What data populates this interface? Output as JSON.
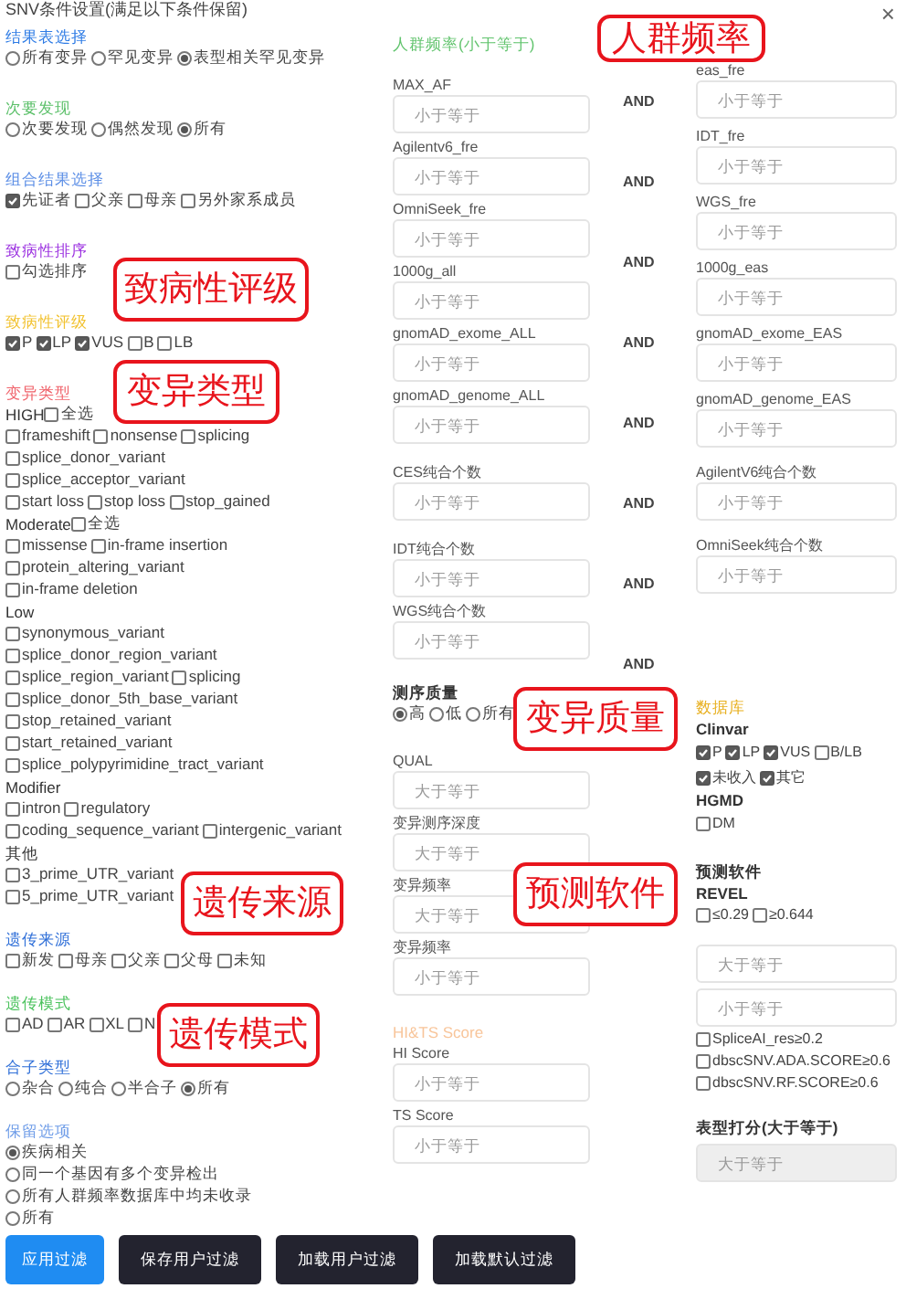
{
  "window": {
    "title": "SNV条件设置(满足以下条件保留)",
    "close": "×"
  },
  "left_sections": [
    {
      "title": "结果表选择",
      "color": "#2d7be5",
      "kind": "radio",
      "options": [
        {
          "label": "所有变异",
          "selected": false
        },
        {
          "label": "罕见变异",
          "selected": false
        },
        {
          "label": "表型相关罕见变异",
          "selected": true
        }
      ]
    },
    {
      "title": "次要发现",
      "color": "#5cc06a",
      "kind": "radio",
      "options": [
        {
          "label": "次要发现",
          "selected": false
        },
        {
          "label": "偶然发现",
          "selected": false
        },
        {
          "label": "所有",
          "selected": true
        }
      ]
    },
    {
      "title": "组合结果选择",
      "color": "#5b8ee6",
      "kind": "check",
      "options": [
        {
          "label": "先证者",
          "checked": true
        },
        {
          "label": "父亲",
          "checked": false
        },
        {
          "label": "母亲",
          "checked": false
        },
        {
          "label": "另外家系成员",
          "checked": false
        }
      ]
    },
    {
      "title": "致病性排序",
      "color": "#9b30e0",
      "kind": "check",
      "options": [
        {
          "label": "勾选排序",
          "checked": false
        }
      ]
    },
    {
      "title": "致病性评级",
      "color": "#f2c230",
      "kind": "check",
      "options": [
        {
          "label": "P",
          "checked": true
        },
        {
          "label": "LP",
          "checked": true
        },
        {
          "label": "VUS",
          "checked": true
        },
        {
          "label": "B",
          "checked": false
        },
        {
          "label": "LB",
          "checked": false
        }
      ]
    },
    {
      "title": "变异类型",
      "color": "#f0636b",
      "kind": "types",
      "groups": [
        {
          "name": "HIGH",
          "select_all": {
            "label": "全选",
            "checked": false
          },
          "lines": [
            {
              "options": [
                {
                  "label": "frameshift",
                  "checked": false
                },
                {
                  "label": "nonsense",
                  "checked": false
                },
                {
                  "label": "splicing",
                  "checked": false
                }
              ]
            },
            {
              "options": [
                {
                  "label": "splice_donor_variant",
                  "checked": false
                }
              ]
            },
            {
              "options": [
                {
                  "label": "splice_acceptor_variant",
                  "checked": false
                }
              ]
            },
            {
              "options": [
                {
                  "label": "start loss",
                  "checked": false
                },
                {
                  "label": "stop loss",
                  "checked": false
                },
                {
                  "label": "stop_gained",
                  "checked": false
                }
              ]
            }
          ]
        },
        {
          "name": "Moderate",
          "select_all": {
            "label": "全选",
            "checked": false
          },
          "lines": [
            {
              "options": [
                {
                  "label": "missense",
                  "checked": false
                },
                {
                  "label": "in-frame insertion",
                  "checked": false
                }
              ]
            },
            {
              "options": [
                {
                  "label": "protein_altering_variant",
                  "checked": false
                }
              ]
            },
            {
              "options": [
                {
                  "label": "in-frame deletion",
                  "checked": false
                }
              ]
            }
          ]
        },
        {
          "name": "Low",
          "lines": [
            {
              "options": [
                {
                  "label": "synonymous_variant",
                  "checked": false
                }
              ]
            },
            {
              "options": [
                {
                  "label": "splice_donor_region_variant",
                  "checked": false
                }
              ]
            },
            {
              "options": [
                {
                  "label": "splice_region_variant",
                  "checked": false
                },
                {
                  "label": "splicing",
                  "checked": false
                }
              ]
            },
            {
              "options": [
                {
                  "label": "splice_donor_5th_base_variant",
                  "checked": false
                }
              ]
            },
            {
              "options": [
                {
                  "label": "stop_retained_variant",
                  "checked": false
                }
              ]
            },
            {
              "options": [
                {
                  "label": "start_retained_variant",
                  "checked": false
                }
              ]
            },
            {
              "options": [
                {
                  "label": "splice_polypyrimidine_tract_variant",
                  "checked": false
                }
              ]
            }
          ]
        },
        {
          "name": "Modifier",
          "lines": [
            {
              "options": [
                {
                  "label": "intron",
                  "checked": false
                },
                {
                  "label": "regulatory",
                  "checked": false
                }
              ]
            },
            {
              "options": [
                {
                  "label": "coding_sequence_variant",
                  "checked": false
                },
                {
                  "label": "intergenic_variant",
                  "checked": false
                }
              ]
            }
          ]
        },
        {
          "name": "其他",
          "lines": [
            {
              "options": [
                {
                  "label": "3_prime_UTR_variant",
                  "checked": false
                }
              ]
            },
            {
              "options": [
                {
                  "label": "5_prime_UTR_variant",
                  "checked": false
                }
              ]
            }
          ]
        }
      ]
    },
    {
      "title": "遗传来源",
      "color": "#2f6fd8",
      "kind": "check",
      "options": [
        {
          "label": "新发",
          "checked": false
        },
        {
          "label": "母亲",
          "checked": false
        },
        {
          "label": "父亲",
          "checked": false
        },
        {
          "label": "父母",
          "checked": false
        },
        {
          "label": "未知",
          "checked": false
        }
      ]
    },
    {
      "title": "遗传模式",
      "color": "#4cc35e",
      "kind": "check",
      "options": [
        {
          "label": "AD",
          "checked": false
        },
        {
          "label": "AR",
          "checked": false
        },
        {
          "label": "XL",
          "checked": false
        },
        {
          "label": "N",
          "checked": false
        }
      ]
    },
    {
      "title": "合子类型",
      "color": "#2f6fd8",
      "kind": "radio",
      "options": [
        {
          "label": "杂合",
          "selected": false
        },
        {
          "label": "纯合",
          "selected": false
        },
        {
          "label": "半合子",
          "selected": false
        },
        {
          "label": "所有",
          "selected": true
        }
      ]
    },
    {
      "title": "保留选项",
      "color": "#6f9de8",
      "kind": "radio_list",
      "options": [
        {
          "label": "疾病相关",
          "selected": true
        },
        {
          "label": "同一个基因有多个变异检出",
          "selected": false
        },
        {
          "label": "所有人群频率数据库中均未收录",
          "selected": false
        },
        {
          "label": "所有",
          "selected": false
        }
      ]
    }
  ],
  "frequency": {
    "title": "人群频率(小于等于)",
    "color": "#62c46e",
    "field_groups": [
      [
        {
          "label": "MAX_AF",
          "placeholder": "小于等于"
        },
        {
          "label": "Agilentv6_fre",
          "placeholder": "小于等于"
        },
        {
          "label": "OmniSeek_fre",
          "placeholder": "小于等于"
        },
        {
          "label": "1000g_all",
          "placeholder": "小于等于"
        },
        {
          "label": "gnomAD_exome_ALL",
          "placeholder": "小于等于"
        },
        {
          "label": "gnomAD_genome_ALL",
          "placeholder": "小于等于"
        }
      ],
      [
        {
          "label": "CES纯合个数",
          "placeholder": "小于等于"
        }
      ],
      [
        {
          "label": "IDT纯合个数",
          "placeholder": "小于等于"
        },
        {
          "label": "WGS纯合个数",
          "placeholder": "小于等于"
        }
      ]
    ],
    "and_labels": [
      "AND",
      "AND",
      "AND",
      "AND",
      "AND",
      "AND",
      "AND",
      "AND"
    ],
    "right_groups": [
      [
        {
          "label": "eas_fre",
          "placeholder": "小于等于"
        },
        {
          "label": "IDT_fre",
          "placeholder": "小于等于"
        },
        {
          "label": "WGS_fre",
          "placeholder": "小于等于"
        },
        {
          "label": "1000g_eas",
          "placeholder": "小于等于"
        },
        {
          "label": "gnomAD_exome_EAS",
          "placeholder": "小于等于"
        },
        {
          "label": "gnomAD_genome_EAS",
          "placeholder": "小于等于"
        }
      ],
      [
        {
          "label": "AgilentV6纯合个数",
          "placeholder": "小于等于"
        }
      ],
      [
        {
          "label": "OmniSeek纯合个数",
          "placeholder": "小于等于"
        }
      ]
    ]
  },
  "quality": {
    "title": "测序质量",
    "options": [
      {
        "label": "高",
        "selected": true
      },
      {
        "label": "低",
        "selected": false
      },
      {
        "label": "所有",
        "selected": false
      }
    ],
    "fields": [
      {
        "label": "QUAL",
        "placeholder": "大于等于"
      },
      {
        "label": "变异测序深度",
        "placeholder": "大于等于"
      },
      {
        "label": "变异频率",
        "placeholder": "大于等于"
      },
      {
        "label": "变异频率",
        "placeholder": "小于等于"
      }
    ]
  },
  "hits": {
    "title": "HI&TS Score",
    "color": "#f8c59a",
    "fields": [
      {
        "label": "HI Score",
        "placeholder": "小于等于"
      },
      {
        "label": "TS Score",
        "placeholder": "小于等于"
      }
    ]
  },
  "database": {
    "title": "数据库",
    "color": "#e8b020",
    "groups": [
      {
        "title": "Clinvar",
        "options": [
          {
            "label": "P",
            "checked": true
          },
          {
            "label": "LP",
            "checked": true
          },
          {
            "label": "VUS",
            "checked": true
          },
          {
            "label": "B/LB",
            "checked": false
          },
          {
            "label": "未收入",
            "checked": true
          },
          {
            "label": "其它",
            "checked": true
          }
        ]
      },
      {
        "title": "HGMD",
        "options": [
          {
            "label": "DM",
            "checked": false
          }
        ]
      }
    ]
  },
  "prediction": {
    "title": "预测软件",
    "revel": {
      "title": "REVEL",
      "options": [
        {
          "label": "≤0.29",
          "checked": false
        },
        {
          "label": "≥0.644",
          "checked": false
        }
      ]
    },
    "placeholders": [
      "大于等于",
      "小于等于"
    ],
    "options": [
      {
        "label": "SpliceAI_res≥0.2",
        "checked": false
      },
      {
        "label": "dbscSNV.ADA.SCORE≥0.6",
        "checked": false
      },
      {
        "label": "dbscSNV.RF.SCORE≥0.6",
        "checked": false
      }
    ]
  },
  "phenotype": {
    "title": "表型打分(大于等于)",
    "placeholder": "大于等于",
    "disabled": true
  },
  "buttons": [
    {
      "label": "应用过滤",
      "kind": "primary"
    },
    {
      "label": "保存用户过滤",
      "kind": "dark"
    },
    {
      "label": "加载用户过滤",
      "kind": "dark"
    },
    {
      "label": "加载默认过滤",
      "kind": "dark"
    }
  ],
  "callouts": [
    {
      "text": "人群频率"
    },
    {
      "text": "致病性评级"
    },
    {
      "text": "变异类型"
    },
    {
      "text": "遗传来源"
    },
    {
      "text": "遗传模式"
    },
    {
      "text": "变异质量"
    },
    {
      "text": "预测软件"
    }
  ]
}
